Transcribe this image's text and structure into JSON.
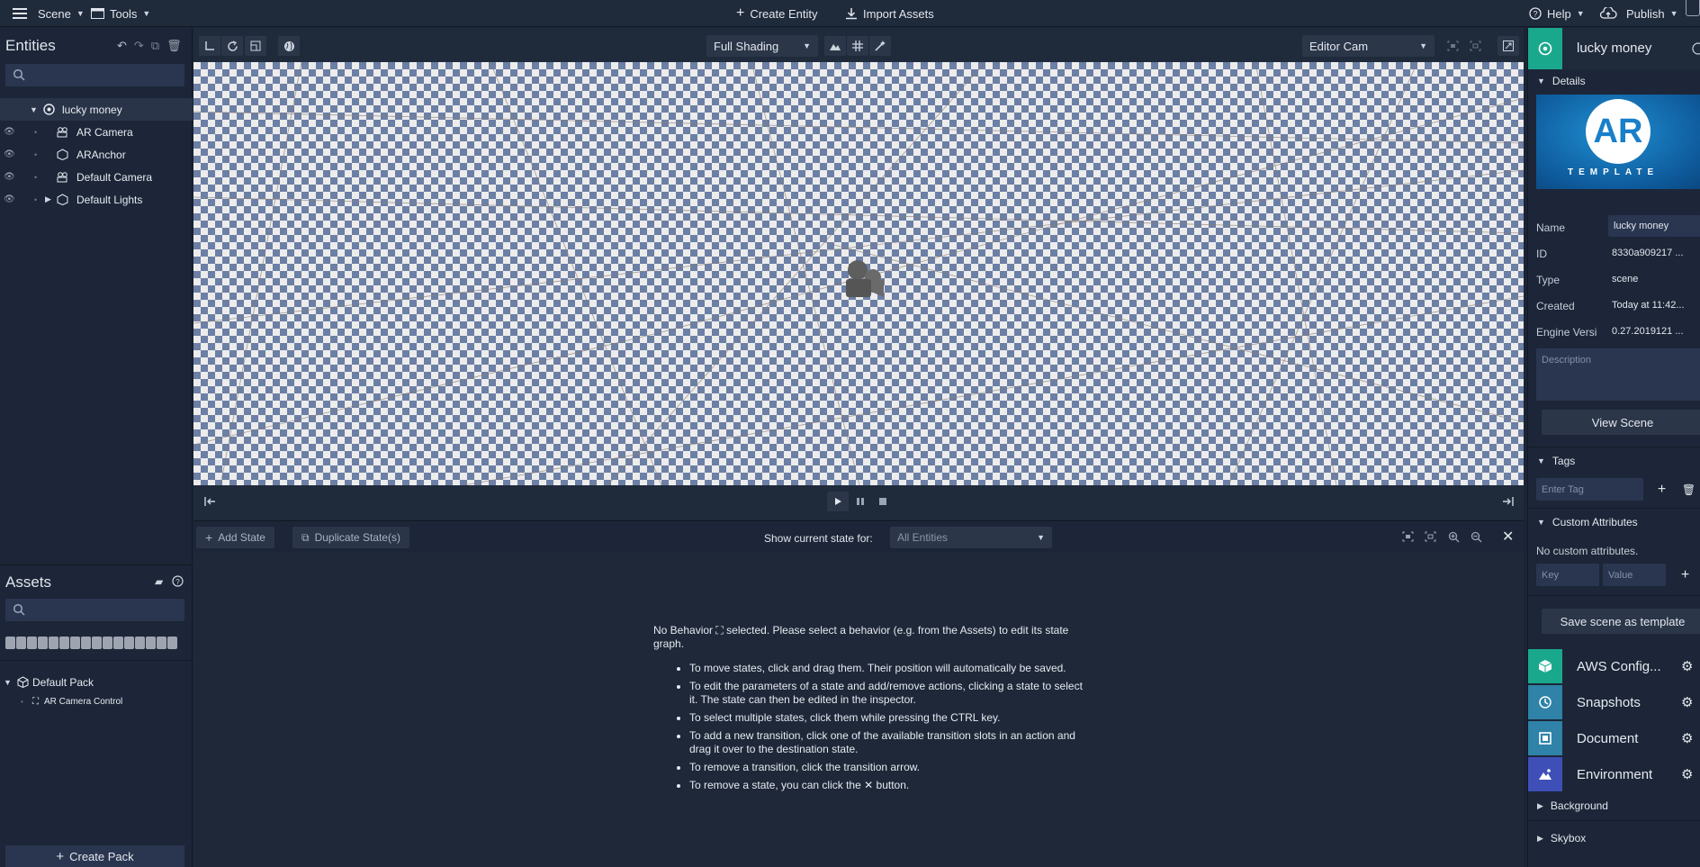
{
  "topbar": {
    "scene_menu": "Scene",
    "tools_menu": "Tools",
    "create_entity": "Create Entity",
    "import_assets": "Import Assets",
    "help_menu": "Help",
    "publish_menu": "Publish"
  },
  "entities": {
    "title": "Entities",
    "search_placeholder": "",
    "root": "lucky money",
    "items": [
      {
        "label": "AR Camera",
        "icon": "camera-icon"
      },
      {
        "label": "ARAnchor",
        "icon": "cube-icon"
      },
      {
        "label": "Default Camera",
        "icon": "camera-icon"
      },
      {
        "label": "Default Lights",
        "icon": "cube-icon"
      }
    ]
  },
  "assets": {
    "title": "Assets",
    "pack_name": "Default Pack",
    "pack_item": "AR Camera Control",
    "create_pack": "Create Pack"
  },
  "viewport": {
    "shading": "Full Shading",
    "camera": "Editor Cam"
  },
  "state_graph": {
    "add_state": "Add State",
    "duplicate_state": "Duplicate State(s)",
    "show_state_label": "Show current state for:",
    "show_state_value": "All Entities",
    "intro_a": "No Behavior",
    "intro_b": "selected. Please select a behavior (e.g. from the Assets) to edit its state graph.",
    "tips": [
      "To move states, click and drag them. Their position will automatically be saved.",
      "To edit the parameters of a state and add/remove actions, clicking a state to select it. The state can then be edited in the inspector.",
      "To select multiple states, click them while pressing the CTRL key.",
      "To add a new transition, click one of the available transition slots in an action and drag it over to the destination state."
    ],
    "tip_remove_transition": "To remove a transition, click the transition arrow.",
    "tip_remove_state_a": "To remove a state, you can click the",
    "tip_remove_state_b": "button."
  },
  "inspector": {
    "title": "lucky money",
    "details_label": "Details",
    "thumb_big": "AR",
    "thumb_small": "TEMPLATE",
    "name_label": "Name",
    "name_value": "lucky money",
    "id_label": "ID",
    "id_value": "8330a909217 ...",
    "type_label": "Type",
    "type_value": "scene",
    "created_label": "Created",
    "created_value": "Today at 11:42...",
    "engine_label": "Engine Versi",
    "engine_value": "0.27.2019121 ...",
    "description_placeholder": "Description",
    "view_scene": "View Scene",
    "tags_label": "Tags",
    "tag_placeholder": "Enter Tag",
    "custom_attr_label": "Custom Attributes",
    "no_custom_attr": "No custom attributes.",
    "key_placeholder": "Key",
    "value_placeholder": "Value",
    "save_template": "Save scene as template",
    "plugins": [
      {
        "label": "AWS Config...",
        "color": "#1aa88d"
      },
      {
        "label": "Snapshots",
        "color": "#2f82a8"
      },
      {
        "label": "Document",
        "color": "#2f82a8"
      },
      {
        "label": "Environment",
        "color": "#3f4fb8"
      }
    ],
    "background_label": "Background",
    "skybox_label": "Skybox"
  }
}
